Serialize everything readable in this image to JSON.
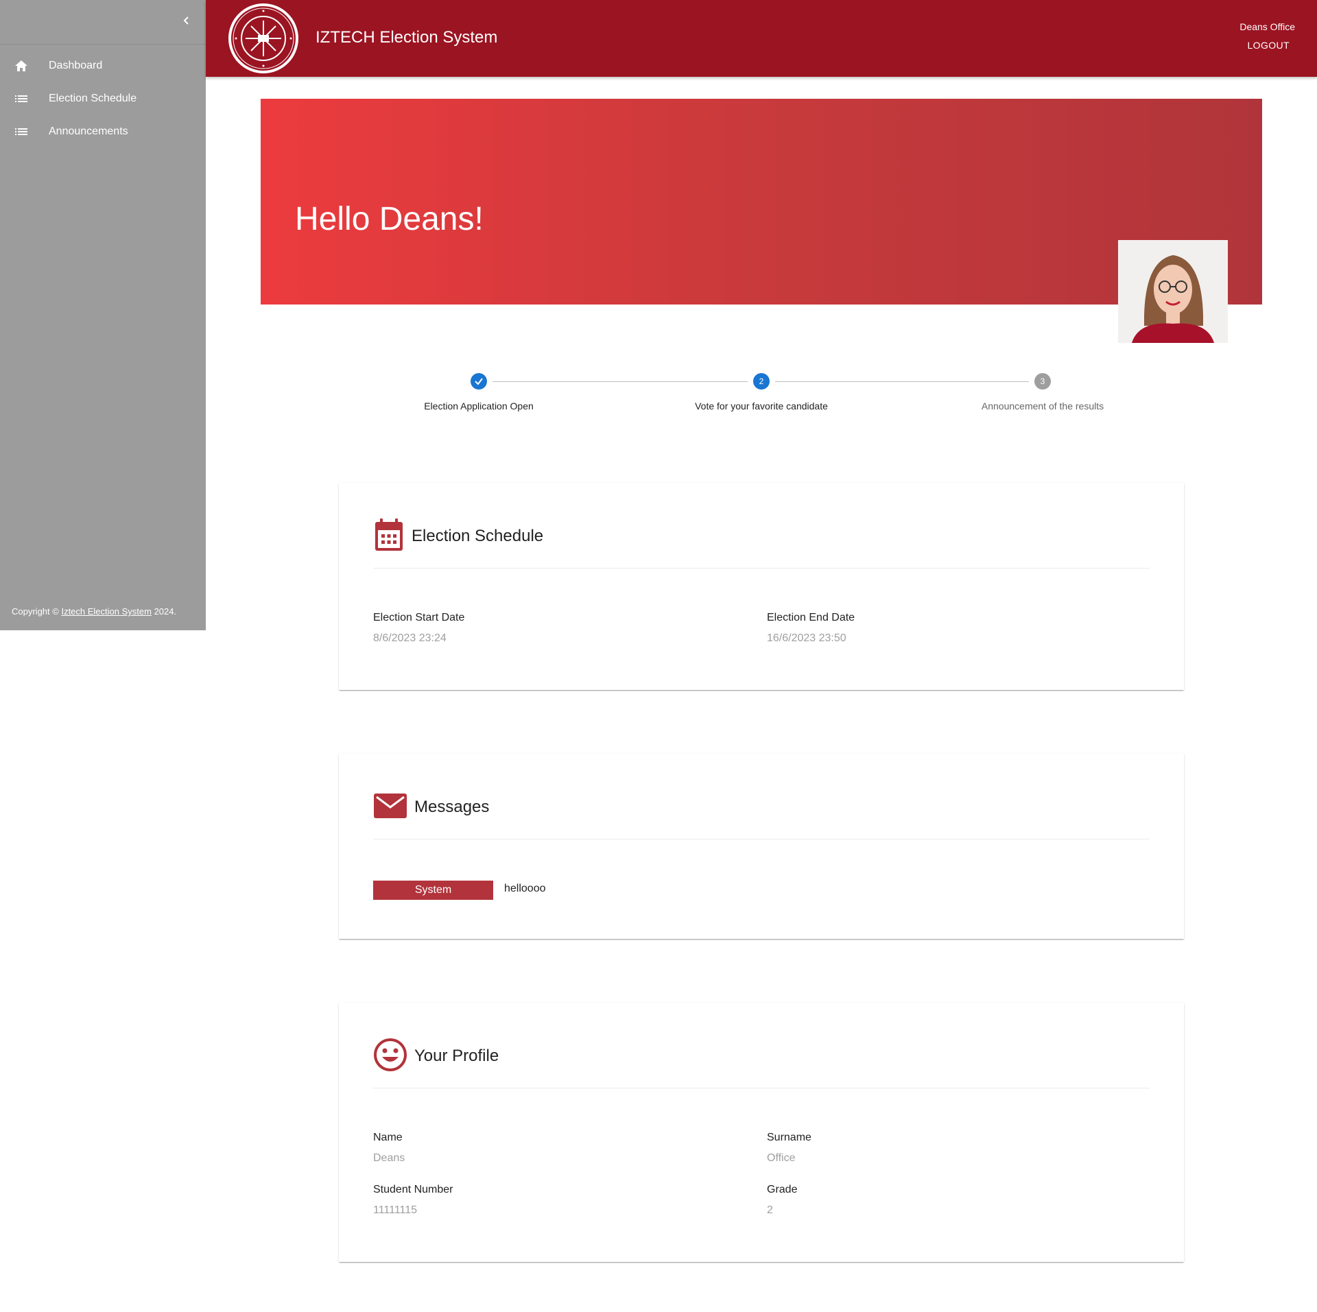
{
  "sidebar": {
    "items": [
      {
        "label": "Dashboard",
        "icon": "home-icon"
      },
      {
        "label": "Election Schedule",
        "icon": "list-icon"
      },
      {
        "label": "Announcements",
        "icon": "list-icon"
      }
    ],
    "copyright_prefix": "Copyright ©",
    "copyright_link": "Iztech Election System",
    "copyright_suffix": "2024."
  },
  "header": {
    "title": "IZTECH Election System",
    "user": "Deans Office",
    "logout": "LOGOUT"
  },
  "hero": {
    "greeting": "Hello Deans!"
  },
  "stepper": {
    "steps": [
      {
        "label": "Election Application Open",
        "state": "completed"
      },
      {
        "label": "Vote for your favorite candidate",
        "number": "2",
        "state": "active"
      },
      {
        "label": "Announcement of the results",
        "number": "3",
        "state": "pending"
      }
    ]
  },
  "schedule": {
    "title": "Election Schedule",
    "start_label": "Election Start Date",
    "start_value": "8/6/2023 23:24",
    "end_label": "Election End Date",
    "end_value": "16/6/2023 23:50"
  },
  "messages": {
    "title": "Messages",
    "items": [
      {
        "sender": "System",
        "text": "helloooo"
      }
    ]
  },
  "profile": {
    "title": "Your Profile",
    "name_label": "Name",
    "name_value": "Deans",
    "surname_label": "Surname",
    "surname_value": "Office",
    "student_number_label": "Student Number",
    "student_number_value": "11111115",
    "grade_label": "Grade",
    "grade_value": "2"
  },
  "colors": {
    "header": "#9b1422",
    "sidebar": "#9c9c9c",
    "accent": "#b2333b",
    "step_active": "#1976d2",
    "step_pending": "#9e9e9e"
  }
}
